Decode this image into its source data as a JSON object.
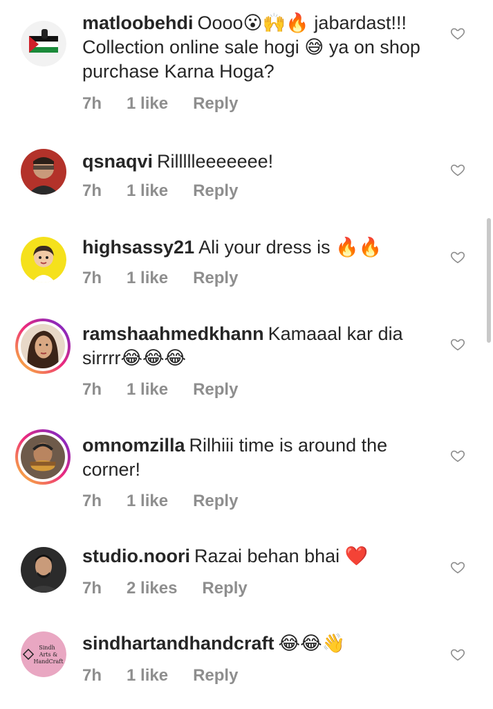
{
  "comments": [
    {
      "username": "matloobehdi",
      "text": "Oooo😮🙌🔥 jabardast!!! Collection online sale hogi 😅 ya on shop purchase Karna Hoga?",
      "time": "7h",
      "likes": "1 like",
      "reply": "Reply",
      "avatar_icon": "flag-fist-avatar"
    },
    {
      "username": "qsnaqvi",
      "text": "Rillllleeeeeee!",
      "time": "7h",
      "likes": "1 like",
      "reply": "Reply",
      "avatar_icon": "man-glasses-avatar"
    },
    {
      "username": "highsassy21",
      "text": "Ali your dress is 🔥🔥",
      "time": "7h",
      "likes": "1 like",
      "reply": "Reply",
      "avatar_icon": "cartoon-girl-avatar"
    },
    {
      "username": "ramshaahmedkhann",
      "text": "Kamaaal kar dia sirrrr😂😂😂",
      "time": "7h",
      "likes": "1 like",
      "reply": "Reply",
      "avatar_icon": "woman-portrait-avatar"
    },
    {
      "username": "omnomzilla",
      "text": "Rilhiii time is around the corner!",
      "time": "7h",
      "likes": "1 like",
      "reply": "Reply",
      "avatar_icon": "man-eating-avatar"
    },
    {
      "username": "studio.noori",
      "text": "Razai behan bhai ❤️",
      "time": "7h",
      "likes": "2 likes",
      "reply": "Reply",
      "avatar_icon": "man-portrait-avatar"
    },
    {
      "username": "sindhartandhandcraft",
      "text": "😂😂👋",
      "time": "7h",
      "likes": "1 like",
      "reply": "Reply",
      "avatar_icon": "sindh-arts-logo-avatar",
      "avatar_logo_text": "Sindh Arts & HandCraft"
    }
  ],
  "colors": {
    "text": "#262626",
    "meta": "#8e8e8e",
    "ring_gradient": [
      "#f9ce34",
      "#ee2a7b",
      "#6228d7"
    ]
  }
}
